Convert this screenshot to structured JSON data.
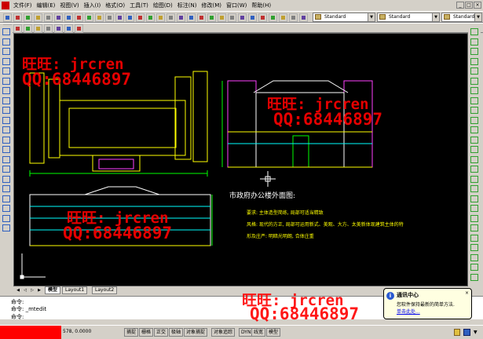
{
  "menu": {
    "items": [
      {
        "label": "文件",
        "key": "(F)"
      },
      {
        "label": "编辑",
        "key": "(E)"
      },
      {
        "label": "视图",
        "key": "(V)"
      },
      {
        "label": "插入",
        "key": "(I)"
      },
      {
        "label": "格式",
        "key": "(O)"
      },
      {
        "label": "工具",
        "key": "(T)"
      },
      {
        "label": "绘图",
        "key": "(D)"
      },
      {
        "label": "标注",
        "key": "(N)"
      },
      {
        "label": "修改",
        "key": "(M)"
      },
      {
        "label": "窗口",
        "key": "(W)"
      },
      {
        "label": "帮助",
        "key": "(H)"
      }
    ]
  },
  "toolbar": {
    "text_style": "Standard",
    "dim_style": "Standard",
    "table_style": "Standard"
  },
  "drawing": {
    "title": "市政府办公楼外面图:",
    "lines": [
      "要求: 主体造型简练, 局部可适当精致",
      "风格: 现代的方正, 局部可运用新式、美观、大方、太美新体现建筑主体的特",
      "形及庄严: 明暗光明朗, 合体庄重"
    ]
  },
  "tabs": [
    {
      "label": "模型",
      "active": true
    },
    {
      "label": "Layout1",
      "active": false
    },
    {
      "label": "Layout2",
      "active": false
    }
  ],
  "command": {
    "line1": "命令:",
    "line2": "命令: _mtedit",
    "line3": "命令:"
  },
  "status": {
    "coords": "578, 0.0000",
    "buttons": [
      "捕捉",
      "栅格",
      "正交",
      "极轴",
      "对象捕捉",
      "对象追踪",
      "DYN",
      "线宽",
      "模型"
    ]
  },
  "balloon": {
    "title": "通讯中心",
    "text": "您软件保持最新的简单方法.",
    "link": "单击此处..."
  },
  "watermarks": {
    "wangwang": "旺旺: jrcren",
    "qq": "QQ:68446897"
  },
  "colors": {
    "canvas": "#000000",
    "outline_yellow": "#ffff00",
    "outline_magenta": "#ff40ff",
    "outline_green": "#00ff00",
    "outline_white": "#ffffff",
    "outline_cyan": "#00ffff",
    "watermark": "#ff0000"
  }
}
